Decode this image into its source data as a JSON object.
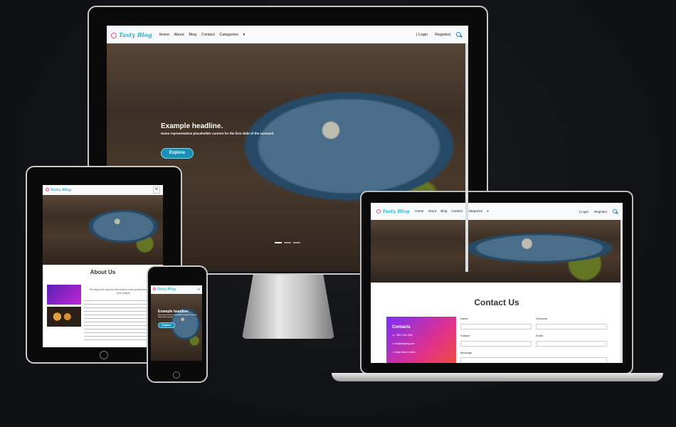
{
  "brand": {
    "name": "Tasty Blog"
  },
  "nav": {
    "links": [
      "Home",
      "About",
      "Blog",
      "Contact",
      "Categories"
    ],
    "login": "| Login",
    "register": "Register|"
  },
  "hero": {
    "headline": "Example headline.",
    "subtext": "Some representative placeholder content for the first slide of the carousel.",
    "button": "Explore"
  },
  "about": {
    "title": "About Us",
    "intro": "This blog is for anyone who loves to cook yummy food and share their recipes."
  },
  "contact": {
    "title": "Contact Us",
    "card_title": "Contacts",
    "phone": "+353 1 000 0000",
    "email": "info@tastyblog.com",
    "address": "1 Main Street, Dublin",
    "labels": {
      "name": "Name",
      "surname": "Surname",
      "subject": "Subject",
      "email": "Email",
      "message": "Message"
    }
  },
  "colors": {
    "brand": "#23b7d2",
    "accent": "#1c8fb5",
    "gradient_start": "#7b2ff7",
    "gradient_end": "#f0503a"
  },
  "icons": {
    "search": "search-icon",
    "caret": "chevron-down-icon",
    "menu": "hamburger-icon",
    "logo": "logo-icon"
  }
}
